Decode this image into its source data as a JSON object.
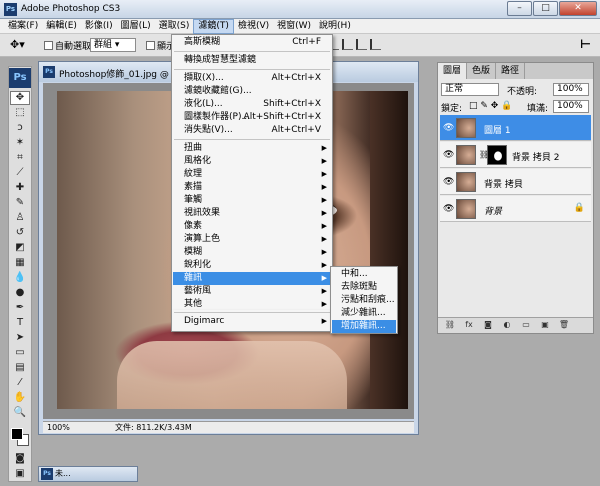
{
  "window": {
    "title": "Adobe Photoshop CS3",
    "ps_badge": "Ps",
    "min": "–",
    "max": "□",
    "close": "✕"
  },
  "menubar": [
    {
      "label": "檔案(F)"
    },
    {
      "label": "編輯(E)"
    },
    {
      "label": "影像(I)"
    },
    {
      "label": "圖層(L)"
    },
    {
      "label": "選取(S)"
    },
    {
      "label": "濾鏡(T)"
    },
    {
      "label": "檢視(V)"
    },
    {
      "label": "視窗(W)"
    },
    {
      "label": "說明(H)"
    }
  ],
  "options": {
    "auto_select": "自動選取:",
    "group": "群組",
    "show": "顯示"
  },
  "toolbox": {
    "logo": "Ps"
  },
  "document": {
    "title": "Photoshop修飾_01.jpg @ 100% ",
    "zoom": "100%",
    "info": "文件: 811.2K/3.43M",
    "minimized_title": "未..."
  },
  "layers_panel": {
    "tabs": [
      "圖層",
      "色版",
      "路徑"
    ],
    "blend_mode": "正常",
    "opacity_label": "不透明:",
    "opacity_value": "100%",
    "lock_label": "鎖定:",
    "fill_label": "填滿:",
    "fill_value": "100%",
    "layers": [
      {
        "name": "圖層 1",
        "selected": true
      },
      {
        "name": "背景 拷貝 2",
        "selected": false,
        "has_mask": true
      },
      {
        "name": "背景 拷貝",
        "selected": false
      },
      {
        "name": "背景",
        "selected": false,
        "locked": true
      }
    ]
  },
  "filter_menu": {
    "items": [
      {
        "label": "高斯模糊",
        "shortcut": "Ctrl+F"
      },
      {
        "label": "轉換成智慧型濾鏡"
      },
      {
        "label": "擷取(X)...",
        "shortcut": "Alt+Ctrl+X"
      },
      {
        "label": "濾鏡收藏館(G)..."
      },
      {
        "label": "液化(L)...",
        "shortcut": "Shift+Ctrl+X"
      },
      {
        "label": "圖樣製作器(P)...",
        "shortcut": "Alt+Shift+Ctrl+X"
      },
      {
        "label": "消失點(V)...",
        "shortcut": "Alt+Ctrl+V"
      },
      {
        "label": "扭曲"
      },
      {
        "label": "風格化"
      },
      {
        "label": "紋理"
      },
      {
        "label": "素描"
      },
      {
        "label": "筆觸"
      },
      {
        "label": "視訊效果"
      },
      {
        "label": "像素"
      },
      {
        "label": "演算上色"
      },
      {
        "label": "模糊"
      },
      {
        "label": "銳利化"
      },
      {
        "label": "雜訊"
      },
      {
        "label": "藝術風"
      },
      {
        "label": "其他"
      },
      {
        "label": "Digimarc"
      }
    ]
  },
  "noise_submenu": {
    "items": [
      {
        "label": "中和..."
      },
      {
        "label": "去除斑點"
      },
      {
        "label": "污點和刮痕..."
      },
      {
        "label": "減少雜訊..."
      },
      {
        "label": "增加雜訊..."
      }
    ]
  }
}
